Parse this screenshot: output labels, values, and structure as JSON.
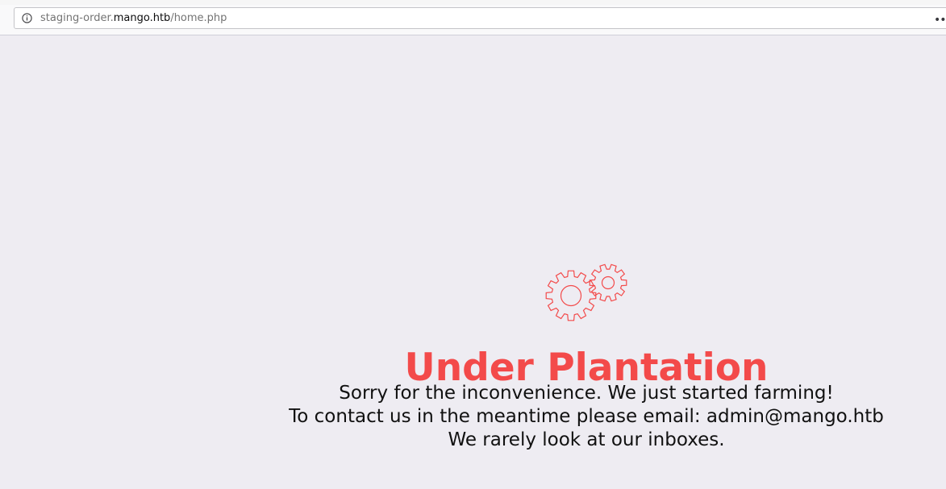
{
  "browser": {
    "url_prefix": "staging-order.",
    "url_host": "mango.htb",
    "url_path": "/home.php",
    "info_icon": "info-icon",
    "more_icon": "more-icon"
  },
  "page": {
    "icon": "gears-icon",
    "heading": "Under Plantation",
    "message_lines": [
      "Sorry for the inconvenience. We just started farming!",
      "To contact us in the meantime please email: admin@mango.htb",
      "We rarely look at our inboxes."
    ]
  },
  "colors": {
    "background": "#eeecf2",
    "accent": "#f34a4a",
    "text": "#111111"
  }
}
